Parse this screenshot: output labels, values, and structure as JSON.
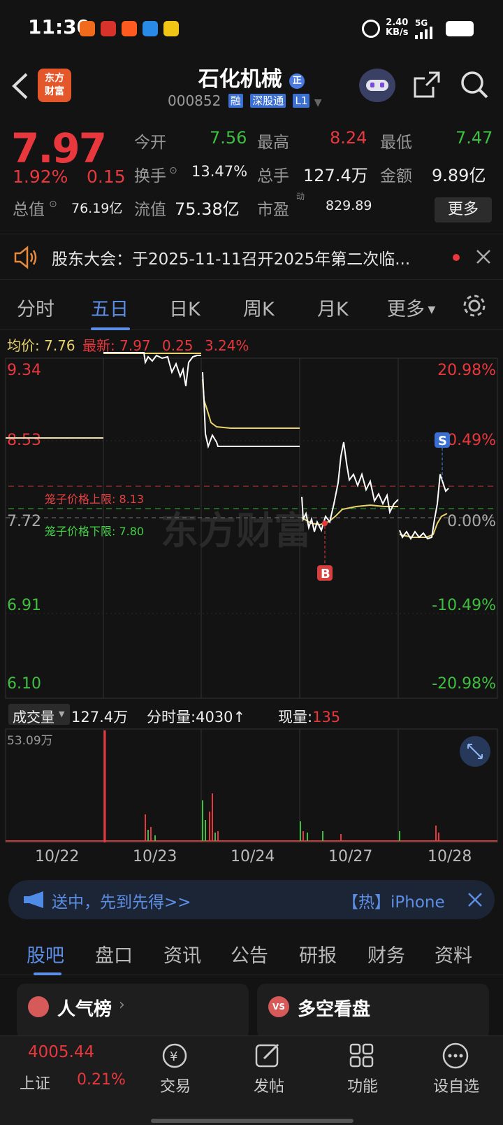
{
  "status_bar": {
    "time": "11:30",
    "speed": "2.40",
    "speed_unit": "KB/s",
    "network": "5G"
  },
  "header": {
    "logo_line1": "东方",
    "logo_line2": "财富",
    "title": "石化机械",
    "title_badge": "正",
    "code": "000852",
    "tags": [
      "融",
      "深股通",
      "L1"
    ]
  },
  "quote": {
    "price": "7.97",
    "change_pct": "1.92%",
    "change_abs": "0.15",
    "open_label": "今开",
    "open": "7.56",
    "high_label": "最高",
    "high": "8.24",
    "low_label": "最低",
    "low": "7.47",
    "turnover_label": "换手",
    "turnover": "13.47%",
    "volume_label": "总手",
    "volume": "127.4万",
    "amount_label": "金额",
    "amount": "9.89亿",
    "mktcap_label": "总值",
    "mktcap": "76.19亿",
    "float_label": "流值",
    "float": "75.38亿",
    "pe_label": "市盈",
    "pe_sup": "动",
    "pe": "829.89",
    "more": "更多"
  },
  "notice": {
    "text": "股东大会：于2025-11-11召开2025年第二次临..."
  },
  "tabs": [
    "分时",
    "五日",
    "日K",
    "周K",
    "月K",
    "更多"
  ],
  "active_tab": "五日",
  "chart_header": {
    "avg_label": "均价:",
    "avg": "7.76",
    "latest_label": "最新:",
    "latest": "7.97",
    "chg": "0.25",
    "chg_pct": "3.24%"
  },
  "chart_labels": {
    "y_left": [
      "9.34",
      "8.53",
      "7.72",
      "6.91",
      "6.10"
    ],
    "y_right": [
      "20.98%",
      "10.49%",
      "0.00%",
      "-10.49%",
      "-20.98%"
    ],
    "cage_upper": "笼子价格上限: 8.13",
    "cage_lower": "笼子价格下限: 7.80",
    "marker_b": "B",
    "marker_s": "S",
    "watermark": "东方财富"
  },
  "volume_header": {
    "selector": "成交量",
    "total": "127.4万",
    "tick_label": "分时量:",
    "tick": "4030",
    "tick_arrow": "↑",
    "now_label": "现量:",
    "now": "135",
    "max": "53.09万"
  },
  "x_dates": [
    "10/22",
    "10/23",
    "10/24",
    "10/27",
    "10/28"
  ],
  "banner": {
    "text": "送中，先到先得>>",
    "hot": "【热】iPhone"
  },
  "sub_tabs": [
    "股吧",
    "盘口",
    "资讯",
    "公告",
    "研报",
    "财务",
    "资料"
  ],
  "cards": {
    "left": "人气榜",
    "right": "多空看盘"
  },
  "bottom": {
    "index_value": "4005.44",
    "index_name": "上证",
    "index_pct": "0.21%",
    "nav": [
      "交易",
      "发帖",
      "功能",
      "设自选"
    ]
  },
  "chart_data": {
    "type": "line",
    "x": [
      "10/22",
      "10/23",
      "10/24",
      "10/27",
      "10/28"
    ],
    "prev_close": 7.72,
    "ylim": [
      6.1,
      9.34
    ],
    "series": [
      {
        "name": "最新",
        "values": [
          8.53,
          9.3,
          8.53,
          7.8,
          7.97
        ]
      },
      {
        "name": "均价",
        "values": [
          8.53,
          9.3,
          8.6,
          7.82,
          7.76
        ]
      }
    ]
  }
}
